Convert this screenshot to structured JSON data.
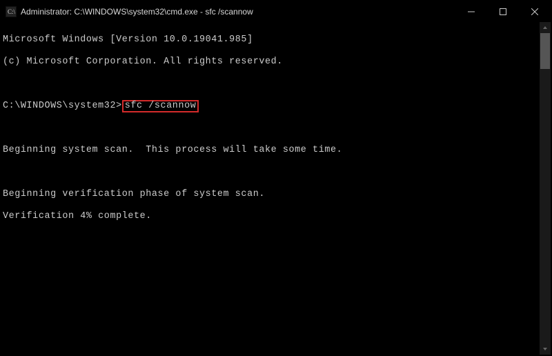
{
  "titlebar": {
    "title": "Administrator: C:\\WINDOWS\\system32\\cmd.exe - sfc  /scannow"
  },
  "terminal": {
    "line1": "Microsoft Windows [Version 10.0.19041.985]",
    "line2": "(c) Microsoft Corporation. All rights reserved.",
    "blank1": "",
    "prompt": "C:\\WINDOWS\\system32>",
    "command": "sfc /scannow",
    "blank2": "",
    "line3": "Beginning system scan.  This process will take some time.",
    "blank3": "",
    "line4": "Beginning verification phase of system scan.",
    "line5": "Verification 4% complete."
  }
}
